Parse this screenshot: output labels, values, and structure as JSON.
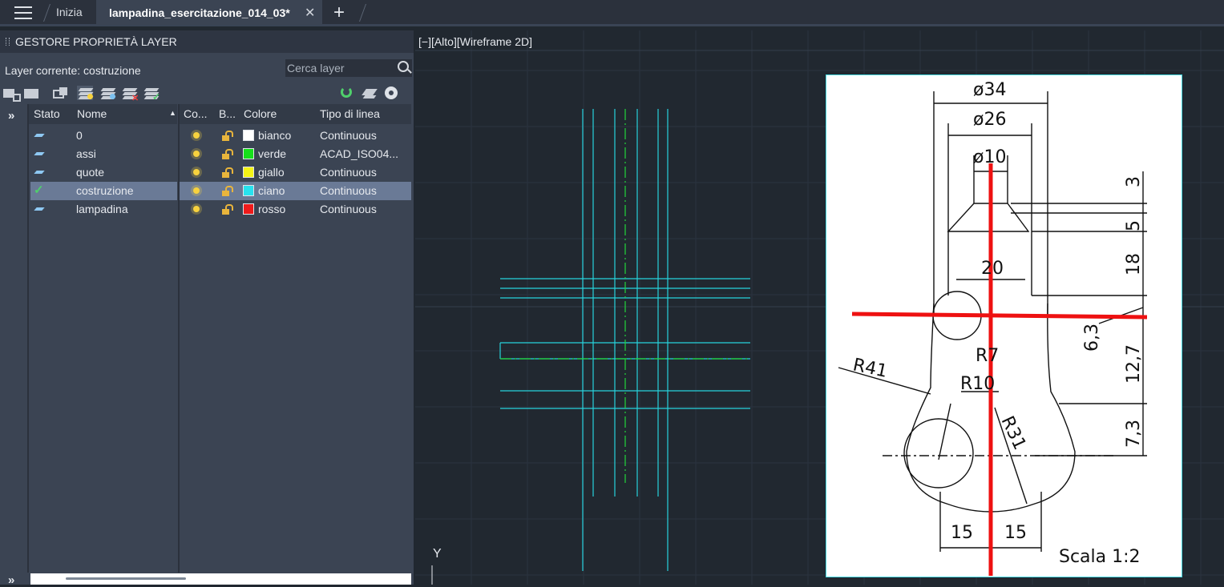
{
  "tabs": {
    "home": "Inizia",
    "active": "lampadina_esercitazione_014_03*",
    "close": "✕",
    "add": "+"
  },
  "layer_panel": {
    "title": "GESTORE PROPRIETÀ LAYER",
    "current_layer_label": "Layer corrente: costruzione",
    "search_placeholder": "Cerca layer",
    "headers": {
      "stato": "Stato",
      "nome": "Nome",
      "co": "Co...",
      "b": "B...",
      "colore": "Colore",
      "tipo": "Tipo di linea"
    },
    "layers": [
      {
        "nome": "0",
        "colore": "bianco",
        "swatch": "#ffffff",
        "tipo": "Continuous",
        "current": false
      },
      {
        "nome": "assi",
        "colore": "verde",
        "swatch": "#16e01a",
        "tipo": "ACAD_ISO04...",
        "current": false
      },
      {
        "nome": "quote",
        "colore": "giallo",
        "swatch": "#f4f416",
        "tipo": "Continuous",
        "current": false
      },
      {
        "nome": "costruzione",
        "colore": "ciano",
        "swatch": "#27e3ef",
        "tipo": "Continuous",
        "current": true
      },
      {
        "nome": "lampadina",
        "colore": "rosso",
        "swatch": "#ef1b1b",
        "tipo": "Continuous",
        "current": false
      }
    ],
    "expand_glyph": "»"
  },
  "viewport": {
    "label": "[−][Alto][Wireframe 2D]",
    "ucs_y": "Y"
  },
  "drawing": {
    "d34": "ø34",
    "d26": "ø26",
    "d10": "ø10",
    "dim3": "3",
    "dim5": "5",
    "dim18": "18",
    "dim20": "20",
    "dim63": "6,3",
    "dim127": "12,7",
    "dim73": "7,3",
    "r41": "R41",
    "r7": "R7",
    "r10": "R10",
    "r31": "R31",
    "b15a": "15",
    "b15b": "15",
    "scala": "Scala  1:2"
  },
  "colors": {
    "cyan": "#27d3dc",
    "green": "#22d63a",
    "red": "#ee1111"
  }
}
